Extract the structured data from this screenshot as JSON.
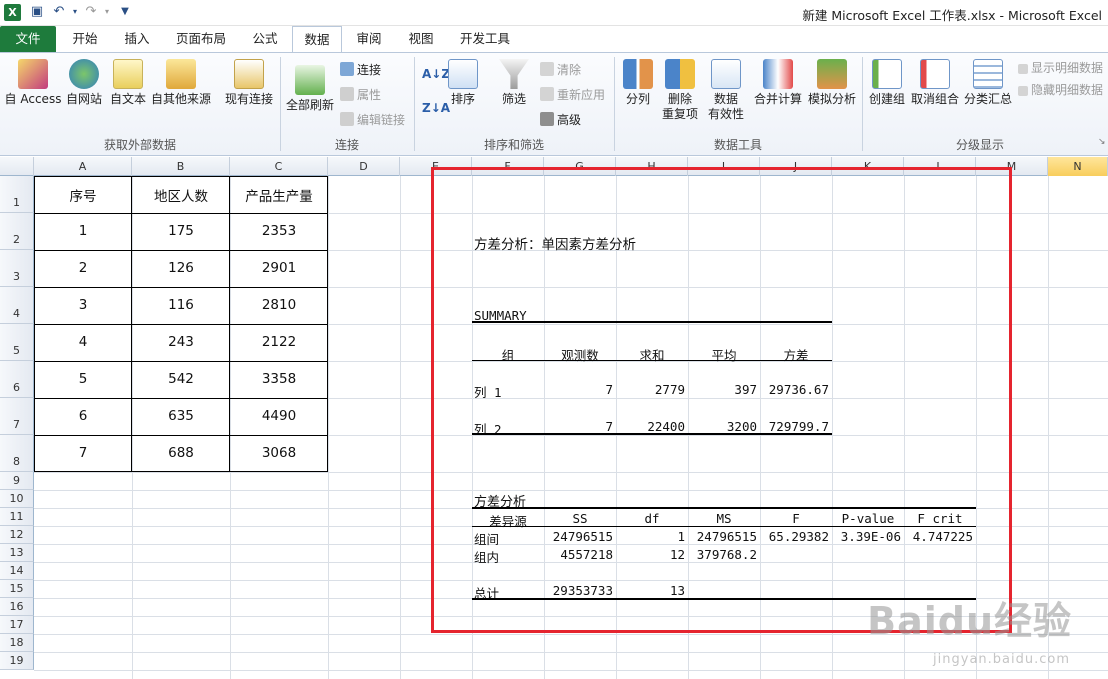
{
  "window": {
    "title": "新建 Microsoft Excel 工作表.xlsx - Microsoft Excel",
    "app_icon": "X"
  },
  "ribbon_tabs": [
    "文件",
    "开始",
    "插入",
    "页面布局",
    "公式",
    "数据",
    "审阅",
    "视图",
    "开发工具"
  ],
  "ribbon": {
    "external_data": {
      "group_label": "获取外部数据",
      "access": "自 Access",
      "web": "自网站",
      "text": "自文本",
      "other": "自其他来源",
      "existing": "现有连接"
    },
    "connections": {
      "group_label": "连接",
      "refresh_all": "全部刷新",
      "connections": "连接",
      "properties": "属性",
      "edit_links": "编辑链接"
    },
    "sort_filter": {
      "group_label": "排序和筛选",
      "sort": "排序",
      "filter": "筛选",
      "clear": "清除",
      "reapply": "重新应用",
      "advanced": "高级"
    },
    "data_tools": {
      "group_label": "数据工具",
      "text_to_columns": "分列",
      "remove_duplicates_1": "删除",
      "remove_duplicates_2": "重复项",
      "validation_1": "数据",
      "validation_2": "有效性",
      "consolidate": "合并计算",
      "what_if": "模拟分析"
    },
    "outline": {
      "group_label": "分级显示",
      "group": "创建组",
      "ungroup": "取消组合",
      "subtotal": "分类汇总",
      "show_detail": "显示明细数据",
      "hide_detail": "隐藏明细数据"
    }
  },
  "columns": [
    "A",
    "B",
    "C",
    "D",
    "E",
    "F",
    "G",
    "H",
    "I",
    "J",
    "K",
    "L",
    "M",
    "N"
  ],
  "rows": [
    "1",
    "2",
    "3",
    "4",
    "5",
    "6",
    "7",
    "8",
    "9",
    "10",
    "11",
    "12",
    "13",
    "14",
    "15",
    "16",
    "17",
    "18",
    "19"
  ],
  "table": {
    "headers": [
      "序号",
      "地区人数",
      "产品生产量"
    ],
    "rows": [
      [
        "1",
        "175",
        "2353"
      ],
      [
        "2",
        "126",
        "2901"
      ],
      [
        "3",
        "116",
        "2810"
      ],
      [
        "4",
        "243",
        "2122"
      ],
      [
        "5",
        "542",
        "3358"
      ],
      [
        "6",
        "635",
        "4490"
      ],
      [
        "7",
        "688",
        "3068"
      ]
    ]
  },
  "anova": {
    "title": "方差分析：单因素方差分析",
    "summary_label": "SUMMARY",
    "summary_headers": [
      "组",
      "观测数",
      "求和",
      "平均",
      "方差"
    ],
    "summary_rows": [
      [
        "列 1",
        "7",
        "2779",
        "397",
        "29736.67"
      ],
      [
        "列 2",
        "7",
        "22400",
        "3200",
        "729799.7"
      ]
    ],
    "anova_label": "方差分析",
    "anova_headers": [
      "差异源",
      "SS",
      "df",
      "MS",
      "F",
      "P-value",
      "F crit"
    ],
    "anova_rows": [
      [
        "组间",
        "24796515",
        "1",
        "24796515",
        "65.29382",
        "3.39E-06",
        "4.747225"
      ],
      [
        "组内",
        "4557218",
        "12",
        "379768.2",
        "",
        "",
        ""
      ],
      [
        "总计",
        "29353733",
        "13",
        "",
        "",
        "",
        ""
      ]
    ]
  },
  "watermark": {
    "main": "Baidu经验",
    "sub": "jingyan.baidu.com"
  }
}
